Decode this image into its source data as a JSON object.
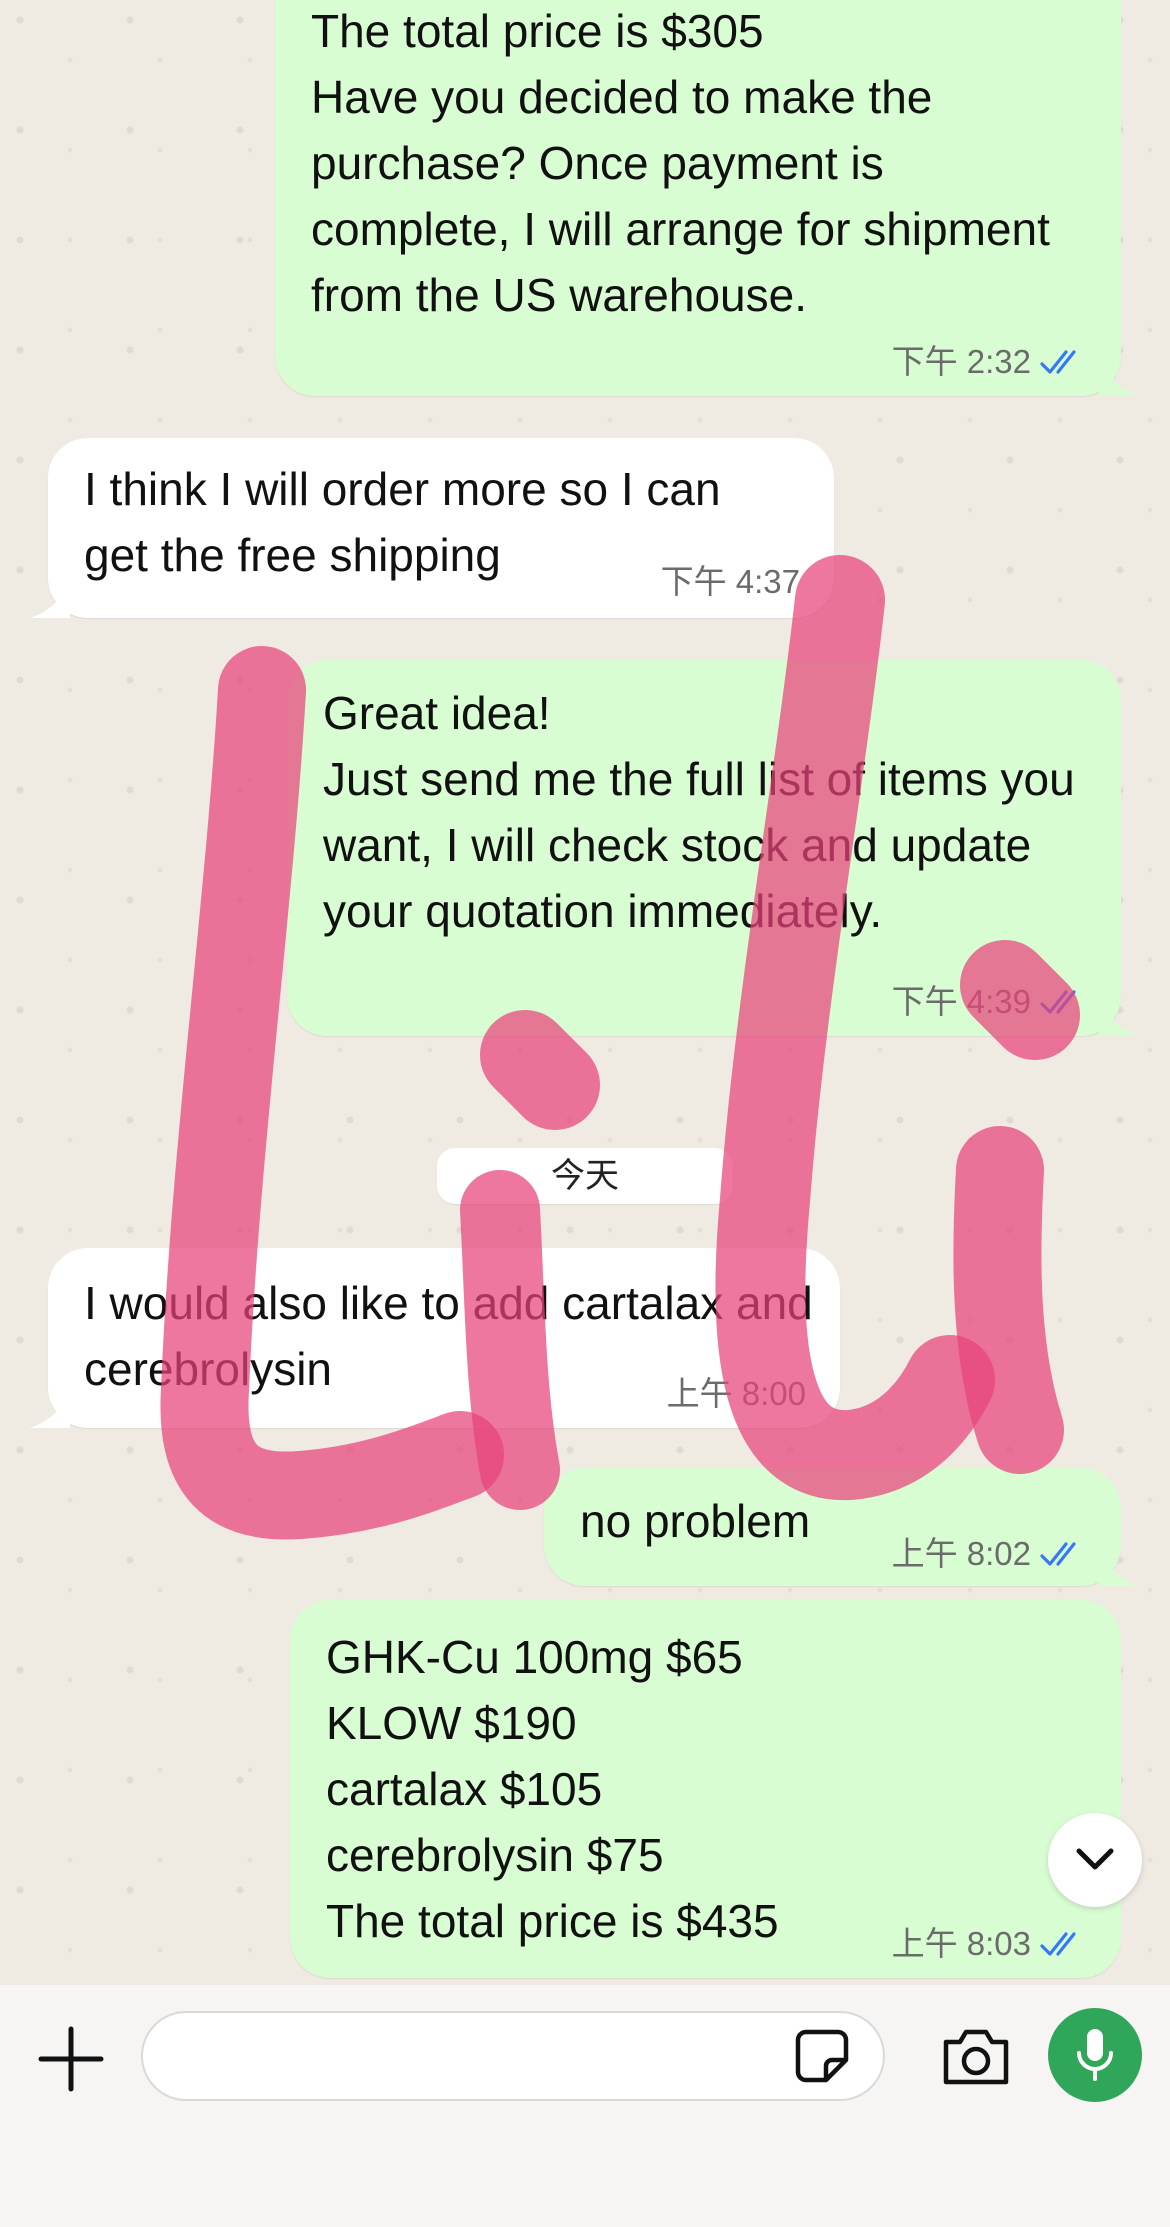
{
  "colors": {
    "outgoing_bubble": "#d9fdd3",
    "incoming_bubble": "#ffffff",
    "read_ticks": "#3478f6",
    "mic_button": "#2fa65a",
    "watermark": "#e8437a"
  },
  "messages": [
    {
      "direction": "out",
      "text": "The total price is $305\nHave you decided to make the purchase? Once payment is complete, I will arrange for shipment from the US warehouse.",
      "time": "下午 2:32",
      "status": "read"
    },
    {
      "direction": "in",
      "text": "I think I will order more so I can get the free shipping",
      "time": "下午 4:37"
    },
    {
      "direction": "out",
      "text": "Great idea!\nJust send me the full list of items you want, I will check stock and update your quotation immediately.",
      "time": "下午 4:39",
      "status": "read"
    },
    {
      "direction": "in",
      "text": "I would also like to add cartalax and cerebrolysin",
      "time": "上午 8:00"
    },
    {
      "direction": "out",
      "text": "no problem",
      "time": "上午 8:02",
      "status": "read"
    },
    {
      "direction": "out",
      "text": "GHK-Cu 100mg $65\nKLOW  $190\ncartalax $105\ncerebrolysin $75\nThe total price is $435",
      "time": "上午 8:03",
      "status": "read"
    }
  ],
  "date_divider": "今天",
  "watermark_text": "Lili",
  "composer": {
    "plus_icon": "plus-icon",
    "sticker_icon": "sticker-icon",
    "camera_icon": "camera-icon",
    "mic_icon": "microphone-icon"
  },
  "scroll_down_icon": "chevron-down-icon"
}
